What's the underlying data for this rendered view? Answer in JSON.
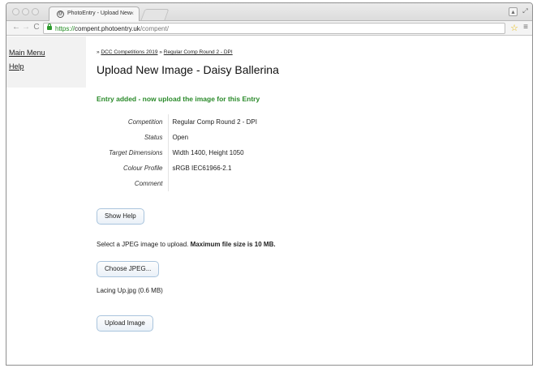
{
  "browser": {
    "tab_title": "PhotoEntry - Upload New",
    "tab_close": "×",
    "url_scheme": "https://",
    "url_host": "compent.photoentry.uk",
    "url_path": "/compent/",
    "favicon": "@",
    "star_icon": "star-icon",
    "menu_icon": "menu-icon"
  },
  "sidebar": {
    "items": [
      {
        "label": "Main Menu"
      },
      {
        "label": "Help"
      }
    ]
  },
  "breadcrumb": {
    "sep": "»",
    "items": [
      {
        "label": "DCC Competitions 2019"
      },
      {
        "label": "Regular Comp Round 2 - DPI"
      }
    ]
  },
  "title": "Upload New Image - Daisy Ballerina",
  "success_message": "Entry added - now upload the image for this Entry",
  "details": [
    {
      "key": "Competition",
      "value": "Regular Comp Round 2 - DPI"
    },
    {
      "key": "Status",
      "value": "Open"
    },
    {
      "key": "Target Dimensions",
      "value": "Width 1400, Height 1050"
    },
    {
      "key": "Colour Profile",
      "value": "sRGB IEC61966-2.1"
    },
    {
      "key": "Comment",
      "value": ""
    }
  ],
  "buttons": {
    "show_help": "Show Help",
    "choose_jpeg": "Choose JPEG...",
    "upload_image": "Upload Image"
  },
  "instructions": {
    "text": "Select a JPEG image to upload.",
    "bold": "Maximum file size is 10 MB."
  },
  "selected_file": "Lacing Up.jpg (0.6 MB)"
}
